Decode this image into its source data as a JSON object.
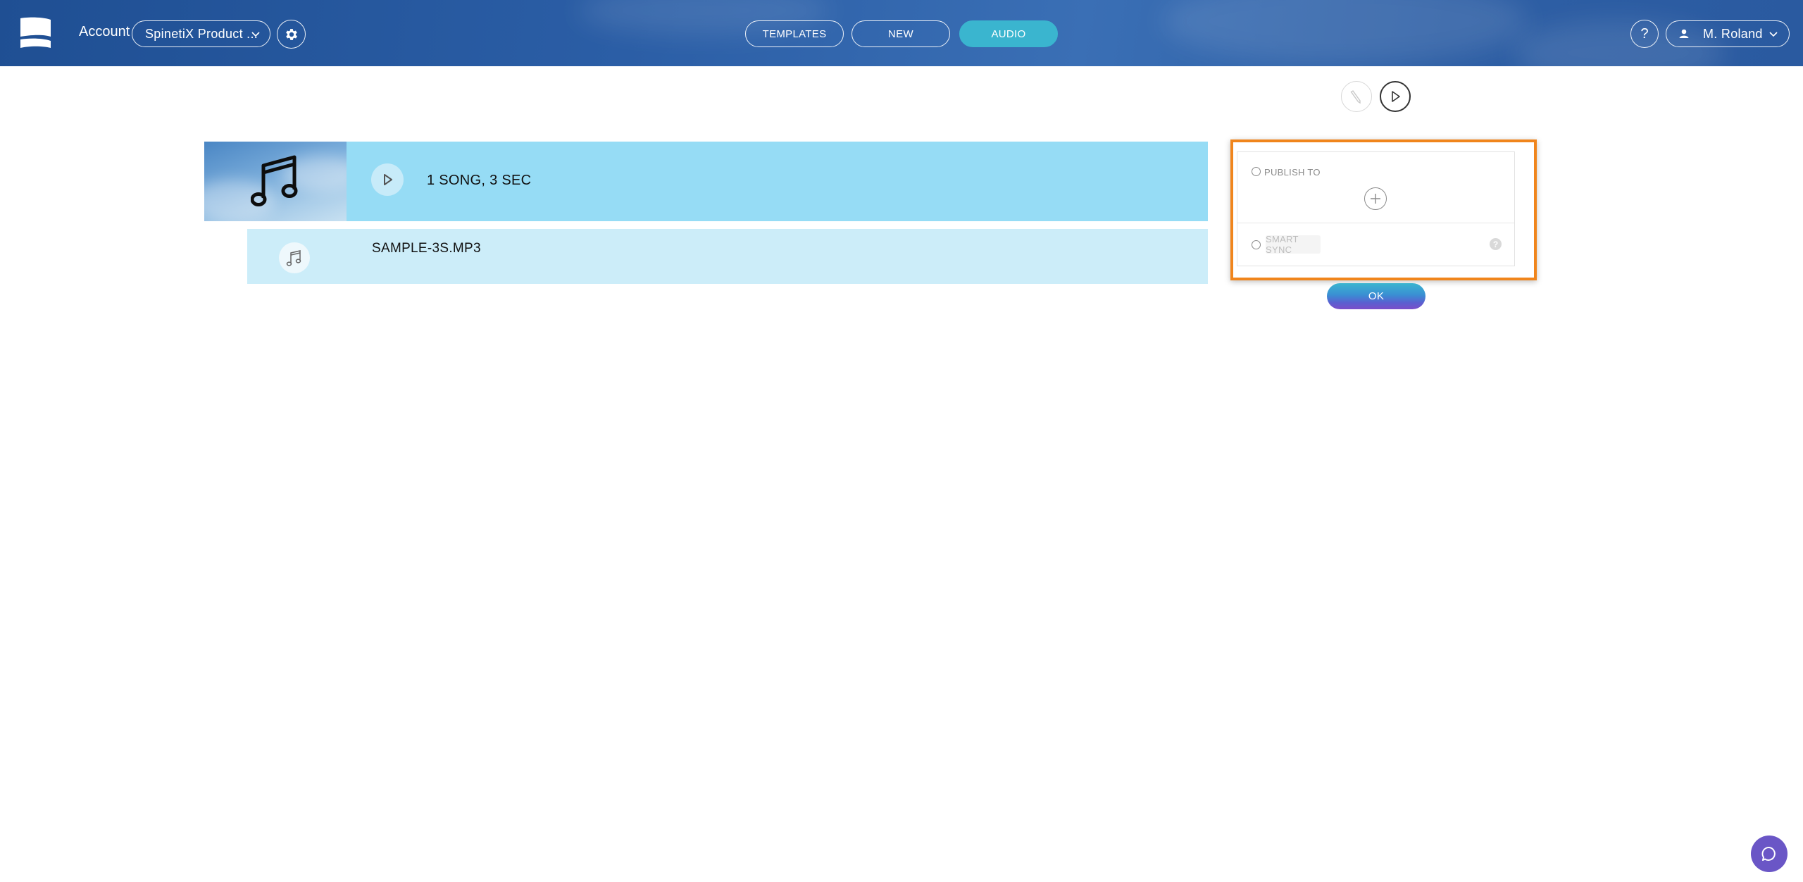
{
  "header": {
    "account_label": "Account",
    "account_selected": "SpinetiX Product ...",
    "tabs": [
      {
        "label": "TEMPLATES",
        "active": false
      },
      {
        "label": "NEW",
        "active": false
      },
      {
        "label": "AUDIO",
        "active": true
      }
    ],
    "help_label": "?",
    "user_name": "M. Roland"
  },
  "toolbar": {
    "icons": [
      "edit-icon",
      "play-icon"
    ]
  },
  "playlist": {
    "summary": "1 SONG, 3 SEC",
    "items": [
      {
        "name": "SAMPLE-3S.MP3",
        "icon": "music-note-icon"
      }
    ]
  },
  "publish_panel": {
    "publish_label": "PUBLISH TO",
    "smart_sync_label": "SMART SYNC",
    "help_label": "?",
    "ok_label": "OK"
  },
  "colors": {
    "header_blue": "#2b5ea6",
    "active_tab": "#3ab5cf",
    "playlist_header": "#96dcf5",
    "playlist_row": "#ccedf9",
    "highlight_outline": "#f0851c",
    "chat_button": "#6a56c6"
  }
}
